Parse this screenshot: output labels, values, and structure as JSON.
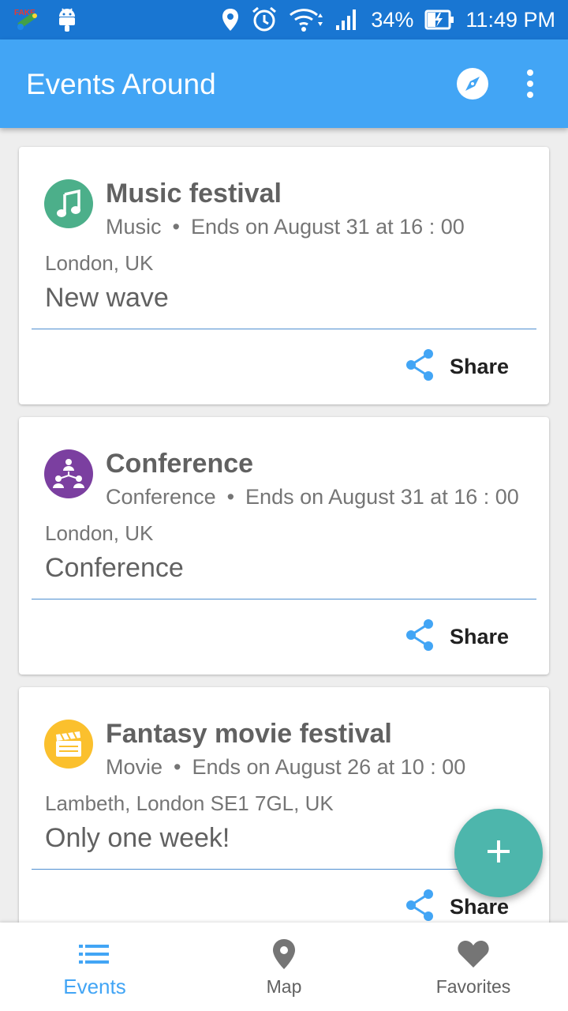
{
  "status_bar": {
    "time": "11:49 PM",
    "battery": "34%",
    "fake_badge": "FAKE"
  },
  "app_bar": {
    "title": "Events Around",
    "compass_icon": "compass-icon",
    "overflow_icon": "overflow-menu-icon"
  },
  "events": [
    {
      "title": "Music festival",
      "category": "Music",
      "ends": "Ends on August 31 at 16 : 00",
      "location": "London, UK",
      "description": "New wave",
      "share_label": "Share",
      "icon": "music-note-icon",
      "color": "#4caf8a"
    },
    {
      "title": "Conference",
      "category": "Conference",
      "ends": "Ends on August 31 at 16 : 00",
      "location": "London, UK",
      "description": "Conference",
      "share_label": "Share",
      "icon": "conference-icon",
      "color": "#7b3fa0"
    },
    {
      "title": "Fantasy movie festival",
      "category": "Movie",
      "ends": "Ends on August 26 at 10 : 00",
      "location": "Lambeth, London SE1 7GL, UK",
      "description": "Only one week!",
      "share_label": "Share",
      "icon": "clapperboard-icon",
      "color": "#fbc02d"
    }
  ],
  "fab": {
    "icon": "plus-icon",
    "color": "#4db6ac"
  },
  "bottom_nav": {
    "events_label": "Events",
    "map_label": "Map",
    "favorites_label": "Favorites",
    "active_color": "#42a5f5"
  }
}
